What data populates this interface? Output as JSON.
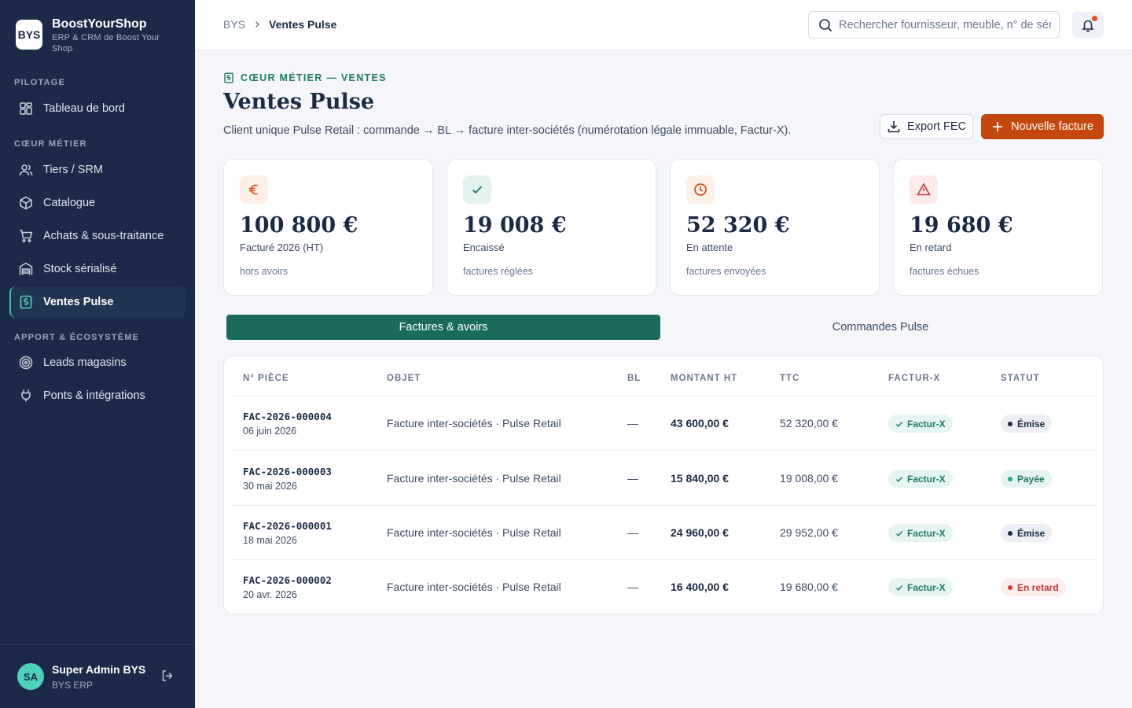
{
  "brand": {
    "logo": "BYS",
    "name": "BoostYourShop",
    "subtitle": "ERP & CRM de Boost Your Shop"
  },
  "sidebar": {
    "sections": [
      {
        "title": "PILOTAGE"
      },
      {
        "title": "CŒUR MÉTIER"
      },
      {
        "title": "APPORT & ÉCOSYSTÈME"
      }
    ],
    "items": [
      {
        "label": "Tableau de bord",
        "icon": "dashboard-icon"
      },
      {
        "label": "Tiers / SRM",
        "icon": "users-icon"
      },
      {
        "label": "Catalogue",
        "icon": "package-icon"
      },
      {
        "label": "Achats & sous-traitance",
        "icon": "cart-icon"
      },
      {
        "label": "Stock sérialisé",
        "icon": "warehouse-icon"
      },
      {
        "label": "Ventes Pulse",
        "icon": "receipt-icon",
        "active": true
      },
      {
        "label": "Leads magasins",
        "icon": "target-icon"
      },
      {
        "label": "Ponts & intégrations",
        "icon": "plug-icon"
      }
    ],
    "user": {
      "initials": "SA",
      "name": "Super Admin BYS",
      "role": "BYS ERP"
    }
  },
  "header": {
    "breadcrumb": {
      "root": "BYS",
      "current": "Ventes Pulse"
    },
    "search": {
      "placeholder": "Rechercher fournisseur, meuble, n° de série…",
      "value": ""
    }
  },
  "page": {
    "eyebrow": "CŒUR MÉTIER — VENTES",
    "title": "Ventes Pulse",
    "description": "Client unique Pulse Retail : commande → BL → facture inter-sociétés (numérotation légale immuable, Factur-X).",
    "export_label": "Export FEC",
    "new_label": "Nouvelle facture"
  },
  "kpis": [
    {
      "value": "100 800 €",
      "label": "Facturé 2026 (HT)",
      "hint": "hors avoirs",
      "icon": "euro-icon",
      "color": "#d9480f"
    },
    {
      "value": "19 008 €",
      "label": "Encaissé",
      "hint": "factures réglées",
      "icon": "check-icon",
      "color": "#1f7a66"
    },
    {
      "value": "52 320 €",
      "label": "En attente",
      "hint": "factures envoyées",
      "icon": "clock-icon",
      "color": "#c4470f"
    },
    {
      "value": "19 680 €",
      "label": "En retard",
      "hint": "factures échues",
      "icon": "alert-triangle-icon",
      "color": "#c23a3a"
    }
  ],
  "tabs": [
    {
      "label": "Factures & avoirs",
      "active": true
    },
    {
      "label": "Commandes Pulse",
      "active": false
    }
  ],
  "table": {
    "columns": [
      "N° PIÈCE",
      "OBJET",
      "BL",
      "MONTANT HT",
      "TTC",
      "FACTUR-X",
      "STATUT"
    ],
    "rows": [
      {
        "number": "FAC-2026-000004",
        "date": "06 juin 2026",
        "object": "Facture inter-sociétés · Pulse Retail",
        "bl": "—",
        "ht": "43 600,00 €",
        "ttc": "52 320,00 €",
        "facturx": "Factur-X",
        "status": "Émise",
        "status_kind": "issued"
      },
      {
        "number": "FAC-2026-000003",
        "date": "30 mai 2026",
        "object": "Facture inter-sociétés · Pulse Retail",
        "bl": "—",
        "ht": "15 840,00 €",
        "ttc": "19 008,00 €",
        "facturx": "Factur-X",
        "status": "Payée",
        "status_kind": "paid"
      },
      {
        "number": "FAC-2026-000001",
        "date": "18 mai 2026",
        "object": "Facture inter-sociétés · Pulse Retail",
        "bl": "—",
        "ht": "24 960,00 €",
        "ttc": "29 952,00 €",
        "facturx": "Factur-X",
        "status": "Émise",
        "status_kind": "issued"
      },
      {
        "number": "FAC-2026-000002",
        "date": "20 avr. 2026",
        "object": "Facture inter-sociétés · Pulse Retail",
        "bl": "—",
        "ht": "16 400,00 €",
        "ttc": "19 680,00 €",
        "facturx": "Factur-X",
        "status": "En retard",
        "status_kind": "late"
      }
    ]
  },
  "colors": {
    "sidebar": "#1b2a49",
    "accent": "#1b6b5c",
    "primary_button": "#c4470f",
    "teal": "#1f7a66"
  }
}
